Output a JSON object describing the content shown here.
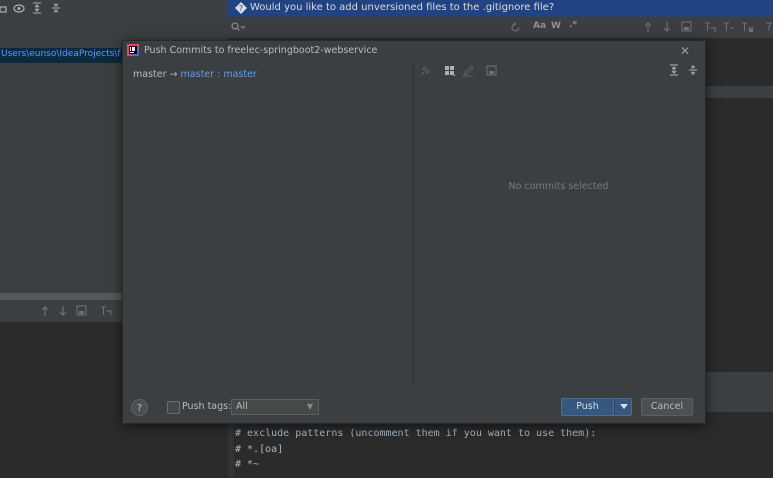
{
  "background": {
    "project_path": "Users\\eunso\\IdeaProjects\\fre",
    "notification": "Would you like to add unversioned files to the .gitignore file?",
    "search_toggles": {
      "match_case": "Aa",
      "words": "W",
      "regex": ".*"
    },
    "editor_lines": [
      "# exclude patterns (uncomment them if you want to use them):",
      "# *.[oa]",
      "# *~"
    ]
  },
  "dialog": {
    "title": "Push Commits to freelec-springboot2-webservice",
    "branch": {
      "local": "master",
      "arrow": "→",
      "remote_target": "master",
      "separator": " : ",
      "remote_branch": "master"
    },
    "empty_message": "No commits selected",
    "footer": {
      "help_label": "?",
      "push_tags_label": "Push tags:",
      "tags_value": "All",
      "push_label": "Push",
      "cancel_label": "Cancel"
    }
  },
  "colors": {
    "accent": "#589df6",
    "primary_button": "#365880",
    "dialog_bg": "#3c3f41",
    "editor_bg": "#2b2b2b"
  }
}
